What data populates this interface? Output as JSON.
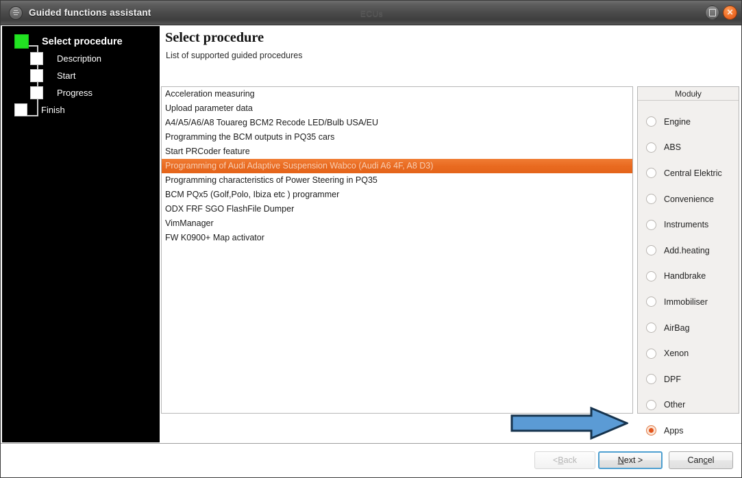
{
  "window": {
    "title": "Guided functions assistant",
    "center_label": "ECUs",
    "app_icon": "menu-circle-icon",
    "maximize_icon": "maximize-icon",
    "close_icon": "close-icon",
    "close_glyph": "✕"
  },
  "sidebar": {
    "steps": [
      {
        "label": "Select procedure",
        "state": "active"
      },
      {
        "label": "Description",
        "state": "pending"
      },
      {
        "label": "Start",
        "state": "pending"
      },
      {
        "label": "Progress",
        "state": "pending"
      },
      {
        "label": "Finish",
        "state": "pending"
      }
    ],
    "active_color": "#22e322"
  },
  "main": {
    "title": "Select procedure",
    "subtitle": "List of supported guided procedures",
    "procedures": [
      {
        "label": "Acceleration measuring",
        "selected": false
      },
      {
        "label": "Upload parameter data",
        "selected": false
      },
      {
        "label": "A4/A5/A6/A8 Touareg BCM2 Recode LED/Bulb USA/EU",
        "selected": false
      },
      {
        "label": "Programming the BCM outputs in PQ35 cars",
        "selected": false
      },
      {
        "label": "Start PRCoder feature",
        "selected": false
      },
      {
        "label": "Programming of Audi Adaptive Suspension Wabco (Audi A6 4F, A8 D3)",
        "selected": true
      },
      {
        "label": "Programming characteristics of Power Steering in PQ35",
        "selected": false
      },
      {
        "label": "BCM PQx5 (Golf,Polo, Ibiza etc ) programmer",
        "selected": false
      },
      {
        "label": "ODX FRF SGO FlashFile Dumper",
        "selected": false
      },
      {
        "label": "VimManager",
        "selected": false
      },
      {
        "label": "FW K0900+ Map activator",
        "selected": false
      }
    ],
    "selected_color": "#e96a20"
  },
  "modules": {
    "header": "Moduły",
    "items": [
      {
        "label": "Engine",
        "checked": false
      },
      {
        "label": "ABS",
        "checked": false
      },
      {
        "label": "Central Elektric",
        "checked": false
      },
      {
        "label": "Convenience",
        "checked": false
      },
      {
        "label": "Instruments",
        "checked": false
      },
      {
        "label": "Add.heating",
        "checked": false
      },
      {
        "label": "Handbrake",
        "checked": false
      },
      {
        "label": "Immobiliser",
        "checked": false
      },
      {
        "label": "AirBag",
        "checked": false
      },
      {
        "label": "Xenon",
        "checked": false
      },
      {
        "label": "DPF",
        "checked": false
      },
      {
        "label": "Other",
        "checked": false
      },
      {
        "label": "Apps",
        "checked": true
      }
    ],
    "checked_color": "#e2541c"
  },
  "annotation": {
    "arrow": "right-arrow-annotation",
    "fill": "#5b9bd5",
    "stroke": "#16334d"
  },
  "footer": {
    "back": {
      "prefix": "< ",
      "accel": "B",
      "suffix": "ack",
      "enabled": false
    },
    "next": {
      "prefix": "",
      "accel": "N",
      "suffix": "ext >",
      "enabled": true,
      "focused": true
    },
    "cancel": {
      "prefix": "Can",
      "accel": "c",
      "suffix": "el",
      "enabled": true
    }
  }
}
